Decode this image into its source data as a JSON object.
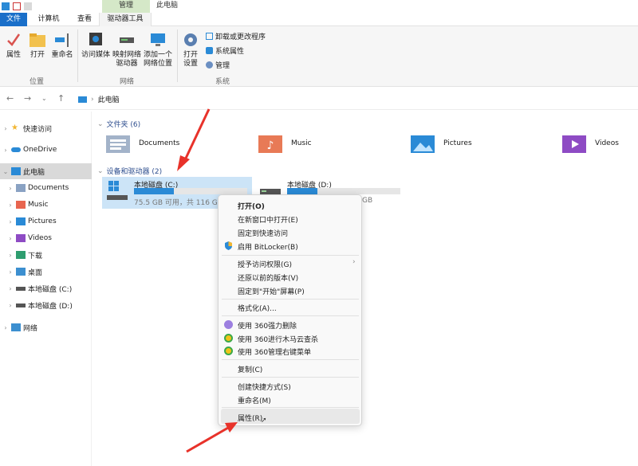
{
  "window": {
    "title": "此电脑",
    "manage_tab": "管理"
  },
  "tabs": {
    "file": "文件",
    "computer": "计算机",
    "view": "查看",
    "drive_tools": "驱动器工具"
  },
  "ribbon": {
    "properties": "属性",
    "open": "打开",
    "rename": "重命名",
    "location_group": "位置",
    "access_media": "访问媒体",
    "map_drive_1": "映射网络",
    "map_drive_2": "驱动器",
    "add_location_1": "添加一个",
    "add_location_2": "网络位置",
    "network_group": "网络",
    "open_settings_1": "打开",
    "open_settings_2": "设置",
    "uninstall": "卸载或更改程序",
    "system_properties": "系统属性",
    "manage": "管理",
    "system_group": "系统"
  },
  "address": {
    "crumb": "此电脑"
  },
  "sidebar": {
    "items": [
      {
        "label": "快速访问",
        "icon": "star-icon"
      },
      {
        "label": "OneDrive",
        "icon": "cloud-icon"
      },
      {
        "label": "此电脑",
        "icon": "computer-icon"
      },
      {
        "label": "Documents",
        "icon": "documents-icon"
      },
      {
        "label": "Music",
        "icon": "music-icon"
      },
      {
        "label": "Pictures",
        "icon": "pictures-icon"
      },
      {
        "label": "Videos",
        "icon": "videos-icon"
      },
      {
        "label": "下载",
        "icon": "download-icon"
      },
      {
        "label": "桌面",
        "icon": "desktop-icon"
      },
      {
        "label": "本地磁盘 (C:)",
        "icon": "drive-icon"
      },
      {
        "label": "本地磁盘 (D:)",
        "icon": "drive-icon"
      },
      {
        "label": "网络",
        "icon": "network-icon"
      }
    ]
  },
  "main": {
    "folders_title": "文件夹 (6)",
    "folders": [
      "Documents",
      "Music",
      "Pictures",
      "Videos"
    ],
    "drives_title": "设备和驱动器 (2)",
    "drives": [
      {
        "name": "本地磁盘 (C:)",
        "info": "75.5 GB 可用，共 116 GB",
        "used_fraction": 0.35
      },
      {
        "name": "本地磁盘 (D:)",
        "info": "GB",
        "used_fraction": 0.27
      }
    ]
  },
  "context_menu": {
    "open": "打开(O)",
    "open_new_window": "在新窗口中打开(E)",
    "pin_quick": "固定到快速访问",
    "bitlocker": "启用 BitLocker(B)",
    "grant_access": "授予访问权限(G)",
    "restore_versions": "还原以前的版本(V)",
    "pin_start": "固定到\"开始\"屏幕(P)",
    "format": "格式化(A)...",
    "del360": "使用 360强力删除",
    "scan360": "使用 360进行木马云查杀",
    "manage360": "使用 360管理右键菜单",
    "copy": "复制(C)",
    "shortcut": "创建快捷方式(S)",
    "rename": "重命名(M)",
    "properties": "属性(R)"
  },
  "colors": {
    "accent": "#1a6fc9",
    "annotation_arrow": "#e8322a",
    "manage_tab": "#d5e8c8"
  }
}
